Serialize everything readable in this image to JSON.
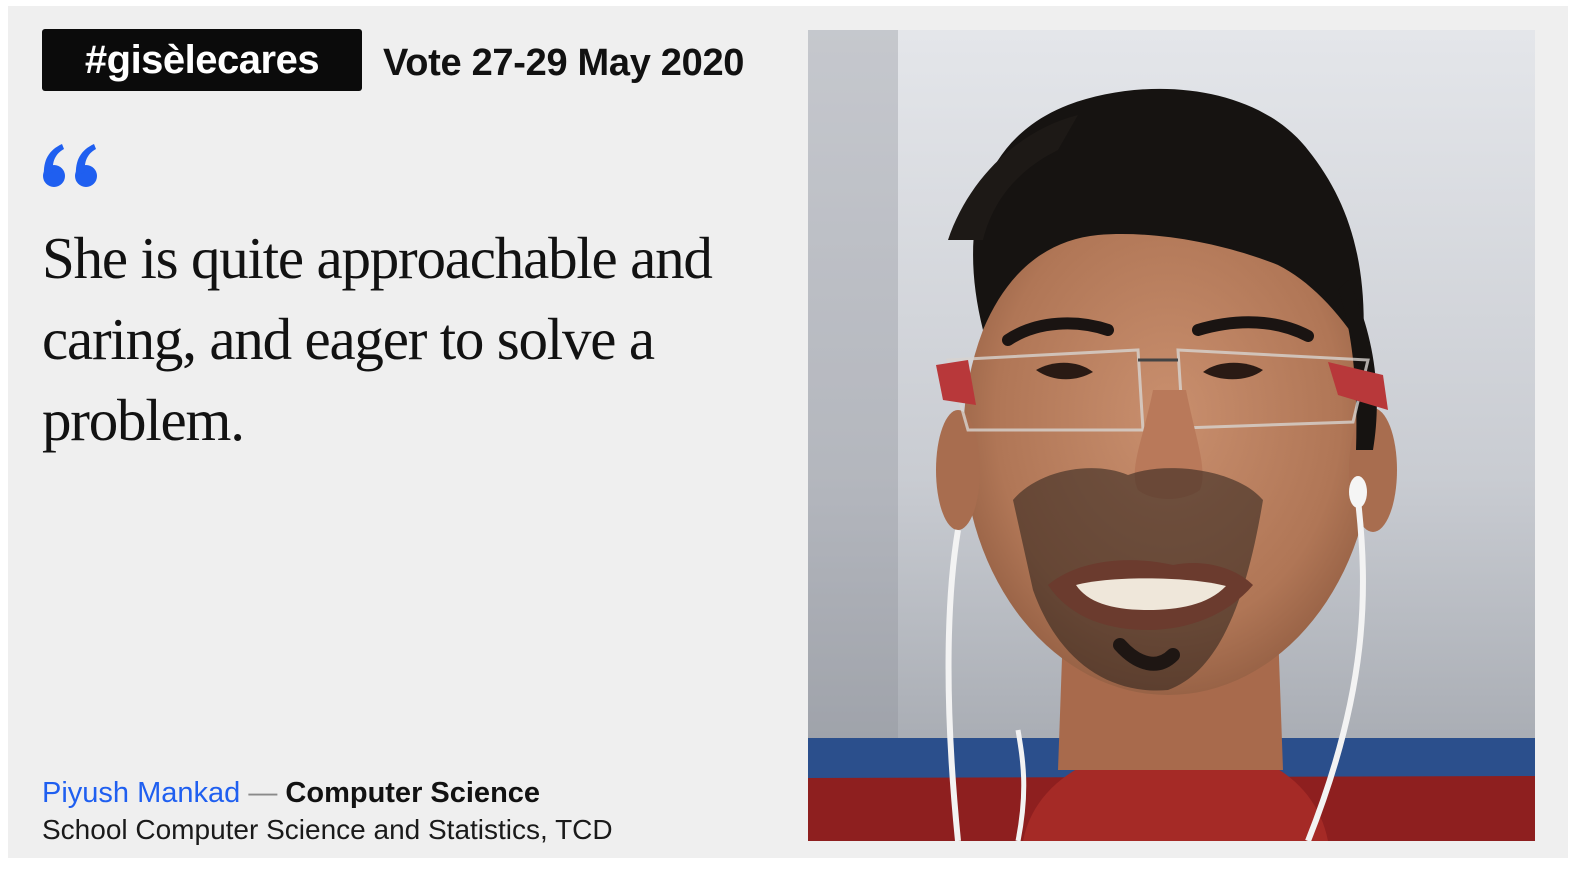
{
  "campaign": {
    "hashtag": "#gisèlecares",
    "vote_dates": "Vote 27-29 May 2020"
  },
  "quote": {
    "icon": "opening-quote-icon",
    "text": "She is quite approachable and caring, and eager to solve a problem."
  },
  "attribution": {
    "name": "Piyush Mankad",
    "separator": "—",
    "course": "Computer Science",
    "school": "School Computer Science and Statistics, TCD"
  },
  "photo": {
    "subject": "student portrait"
  },
  "colors": {
    "accent": "#1f5ff0",
    "card_background": "#efefef",
    "badge_background": "#0b0b0b"
  }
}
